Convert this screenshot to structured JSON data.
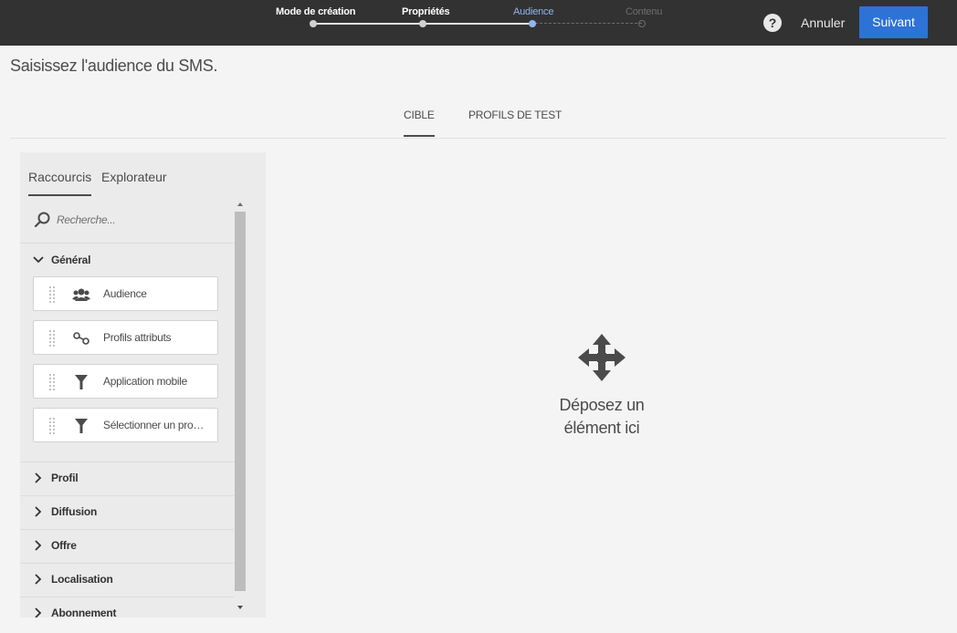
{
  "wizard": {
    "steps": [
      {
        "label": "Mode de création",
        "state": "done"
      },
      {
        "label": "Propriétés",
        "state": "done"
      },
      {
        "label": "Audience",
        "state": "active"
      },
      {
        "label": "Contenu",
        "state": "future"
      }
    ],
    "help_label": "?",
    "cancel_label": "Annuler",
    "next_label": "Suivant"
  },
  "page": {
    "title": "Saisissez l'audience du SMS."
  },
  "main_tabs": [
    {
      "label": "CIBLE",
      "selected": true
    },
    {
      "label": "PROFILS DE TEST",
      "selected": false
    }
  ],
  "panel": {
    "tabs": [
      {
        "label": "Raccourcis",
        "selected": true
      },
      {
        "label": "Explorateur",
        "selected": false
      }
    ],
    "search": {
      "placeholder": "Recherche...",
      "value": ""
    },
    "sections": [
      {
        "label": "Général",
        "expanded": true,
        "items": [
          {
            "label": "Audience",
            "icon": "audience-icon"
          },
          {
            "label": "Profils attributs",
            "icon": "link-attributes-icon"
          },
          {
            "label": "Application mobile",
            "icon": "filter-icon"
          },
          {
            "label": "Sélectionner un pro…",
            "icon": "filter-icon"
          }
        ]
      },
      {
        "label": "Profil",
        "expanded": false
      },
      {
        "label": "Diffusion",
        "expanded": false
      },
      {
        "label": "Offre",
        "expanded": false
      },
      {
        "label": "Localisation",
        "expanded": false
      },
      {
        "label": "Abonnement",
        "expanded": false
      }
    ]
  },
  "dropzone": {
    "line1": "Déposez un",
    "line2": "élément ici",
    "icon": "move-icon"
  },
  "colors": {
    "topbar": "#323232",
    "primary": "#2d73d6",
    "active_step": "#8fb6ee",
    "background": "#f4f4f4",
    "panel": "#ebebeb"
  }
}
